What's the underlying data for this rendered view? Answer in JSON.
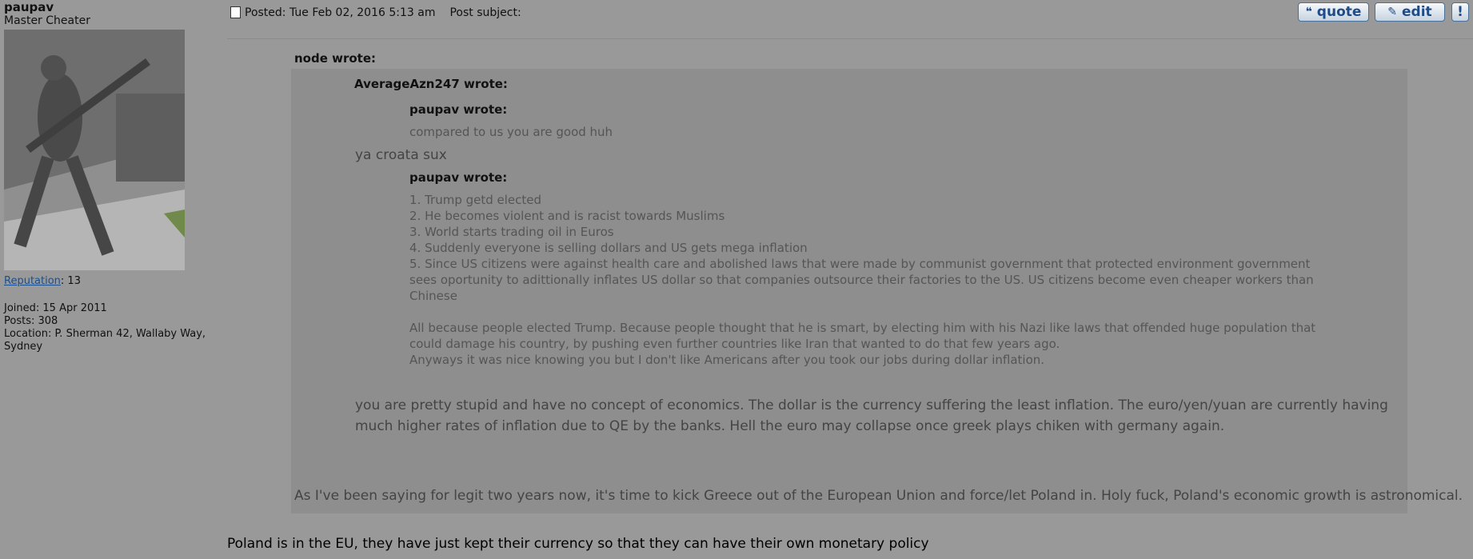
{
  "user": {
    "username": "paupav",
    "rank": "Master Cheater",
    "reputation_label": "Reputation",
    "reputation_value": ": 13",
    "joined": "Joined: 15 Apr 2011",
    "posts": "Posts: 308",
    "location_line1": "Location: P. Sherman 42, Wallaby Way,",
    "location_line2": "Sydney"
  },
  "post": {
    "posted": "Posted: Tue Feb 02, 2016 5:13 am",
    "subject": "Post subject:",
    "buttons": {
      "quote": "quote",
      "edit": "edit",
      "report": "!"
    }
  },
  "quotes": {
    "node": {
      "label": "node wrote:",
      "azn": {
        "label": "AverageAzn247 wrote:",
        "paupav1": {
          "label": "paupav wrote:",
          "text": "compared to us you are good huh"
        },
        "reply": "ya croata sux",
        "paupav2": {
          "label": "paupav wrote:",
          "lines": [
            "1. Trump getd elected",
            "2. He becomes violent and is racist towards Muslims",
            "3. World starts trading oil in Euros",
            "4. Suddenly everyone is selling dollars and US gets mega inflation",
            "5. Since US citizens were against health care and abolished laws that were made by communist government that protected environment government",
            "sees oportunity to adittionally inflates US dollar so that companies outsource their factories to the US. US citizens become even cheaper workers than",
            "Chinese",
            "",
            "All because people elected Trump. Because people thought that he is smart, by electing him with his Nazi like laws that offended huge population that",
            "could damage his country, by pushing even further countries like Iran that wanted to do that few years ago.",
            "Anyways it was nice knowing you but I don't like Americans after you took our jobs during dollar inflation."
          ]
        },
        "response_line1": "you are pretty stupid and have no concept of economics. The dollar is the currency suffering the least inflation. The euro/yen/yuan are currently having",
        "response_line2": "much higher rates of inflation due to QE by the banks. Hell the euro may collapse once greek plays chiken with germany again."
      },
      "response": "As I've been saying for legit two years now, it's time to kick Greece out of the European Union and force/let Poland in. Holy fuck, Poland's economic growth is astronomical."
    }
  },
  "reply": "Poland is in the EU, they have just kept their currency so that they can have their own monetary policy"
}
